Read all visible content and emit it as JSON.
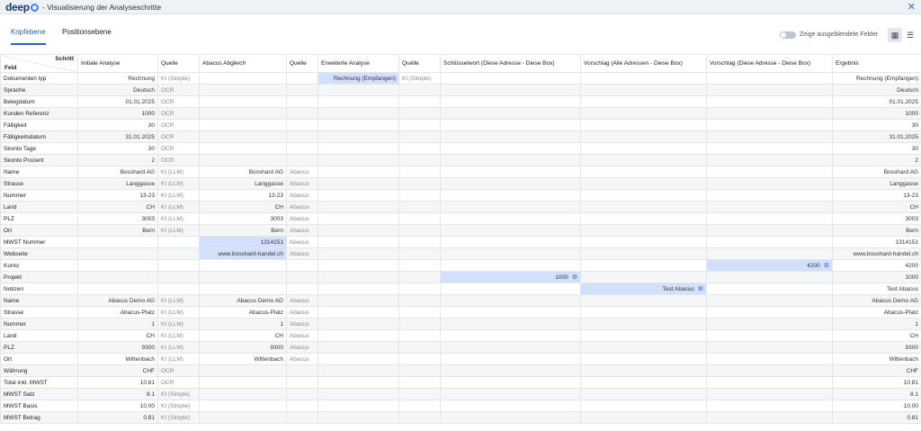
{
  "app": {
    "logo_text": "deep",
    "title": "- Visualisierung der Analyseschritte"
  },
  "tabs": [
    {
      "label": "Kopfebene",
      "active": true
    },
    {
      "label": "Positionsebene",
      "active": false
    }
  ],
  "toolbar": {
    "toggle_label": "Zeige ausgeblendete Felder",
    "toggle_on": false
  },
  "colors": {
    "accent": "#2a62c9",
    "highlight": "#d3e0fb",
    "row_alt": "#f5f6f8"
  },
  "table": {
    "corner_step": "Schritt",
    "corner_field": "Feld",
    "columns": [
      "Initiale Analyse",
      "Quelle",
      "Abacus Abgleich",
      "Quelle",
      "Erweiterte Analyse",
      "Quelle",
      "Schlüsselwort (Diese Adresse - Diese Box)",
      "Vorschlag (Alle Adressen - Diese Box)",
      "Vorschlag (Diese Adresse - Diese Box)",
      "Ergebnis"
    ],
    "rows": [
      {
        "field": "Dokumenten typ",
        "initial": "Rechnung",
        "src1": "KI (Simple)",
        "abacus": "",
        "src2": "",
        "extended": "Rechnung (Empfangen)",
        "src3": "KI (Simple)",
        "keyword": "",
        "sugg_all": "",
        "sugg_this": "",
        "result": "Rechnung (Empfangen)",
        "hl": "extended"
      },
      {
        "field": "Sprache",
        "initial": "Deutsch",
        "src1": "OCR",
        "abacus": "",
        "src2": "",
        "extended": "",
        "src3": "",
        "keyword": "",
        "sugg_all": "",
        "sugg_this": "",
        "result": "Deutsch",
        "hl": ""
      },
      {
        "field": "Belegdatum",
        "initial": "01.01.2025",
        "src1": "OCR",
        "abacus": "",
        "src2": "",
        "extended": "",
        "src3": "",
        "keyword": "",
        "sugg_all": "",
        "sugg_this": "",
        "result": "01.01.2025",
        "hl": ""
      },
      {
        "field": "Kunden Referenz",
        "initial": "1000",
        "src1": "OCR",
        "abacus": "",
        "src2": "",
        "extended": "",
        "src3": "",
        "keyword": "",
        "sugg_all": "",
        "sugg_this": "",
        "result": "1000",
        "hl": ""
      },
      {
        "field": "Fälligkeit",
        "initial": "30",
        "src1": "OCR",
        "abacus": "",
        "src2": "",
        "extended": "",
        "src3": "",
        "keyword": "",
        "sugg_all": "",
        "sugg_this": "",
        "result": "30",
        "hl": ""
      },
      {
        "field": "Fälligkeitsdatum",
        "initial": "31.01.2025",
        "src1": "OCR",
        "abacus": "",
        "src2": "",
        "extended": "",
        "src3": "",
        "keyword": "",
        "sugg_all": "",
        "sugg_this": "",
        "result": "31.01.2025",
        "hl": ""
      },
      {
        "field": "Skonto Tage",
        "initial": "30",
        "src1": "OCR",
        "abacus": "",
        "src2": "",
        "extended": "",
        "src3": "",
        "keyword": "",
        "sugg_all": "",
        "sugg_this": "",
        "result": "30",
        "hl": ""
      },
      {
        "field": "Skonto Prozent",
        "initial": "2",
        "src1": "OCR",
        "abacus": "",
        "src2": "",
        "extended": "",
        "src3": "",
        "keyword": "",
        "sugg_all": "",
        "sugg_this": "",
        "result": "2",
        "hl": ""
      },
      {
        "field": "Name",
        "initial": "Bosshard AG",
        "src1": "KI (LLM)",
        "abacus": "Bosshard AG",
        "src2": "Abacus",
        "extended": "",
        "src3": "",
        "keyword": "",
        "sugg_all": "",
        "sugg_this": "",
        "result": "Bosshard AG",
        "hl": ""
      },
      {
        "field": "Strasse",
        "initial": "Langgasse",
        "src1": "KI (LLM)",
        "abacus": "Langgasse",
        "src2": "Abacus",
        "extended": "",
        "src3": "",
        "keyword": "",
        "sugg_all": "",
        "sugg_this": "",
        "result": "Langgasse",
        "hl": ""
      },
      {
        "field": "Nummer",
        "initial": "13-23",
        "src1": "KI (LLM)",
        "abacus": "13-23",
        "src2": "Abacus",
        "extended": "",
        "src3": "",
        "keyword": "",
        "sugg_all": "",
        "sugg_this": "",
        "result": "13-23",
        "hl": ""
      },
      {
        "field": "Land",
        "initial": "CH",
        "src1": "KI (LLM)",
        "abacus": "CH",
        "src2": "Abacus",
        "extended": "",
        "src3": "",
        "keyword": "",
        "sugg_all": "",
        "sugg_this": "",
        "result": "CH",
        "hl": ""
      },
      {
        "field": "PLZ",
        "initial": "3003",
        "src1": "KI (LLM)",
        "abacus": "3003",
        "src2": "Abacus",
        "extended": "",
        "src3": "",
        "keyword": "",
        "sugg_all": "",
        "sugg_this": "",
        "result": "3003",
        "hl": ""
      },
      {
        "field": "Ort",
        "initial": "Bern",
        "src1": "KI (LLM)",
        "abacus": "Bern",
        "src2": "Abacus",
        "extended": "",
        "src3": "",
        "keyword": "",
        "sugg_all": "",
        "sugg_this": "",
        "result": "Bern",
        "hl": ""
      },
      {
        "field": "MWST Nummer",
        "initial": "",
        "src1": "",
        "abacus": "1314151",
        "src2": "Abacus",
        "extended": "",
        "src3": "",
        "keyword": "",
        "sugg_all": "",
        "sugg_this": "",
        "result": "1314151",
        "hl": "abacus"
      },
      {
        "field": "Webseite",
        "initial": "",
        "src1": "",
        "abacus": "www.bosshard-handel.ch",
        "src2": "Abacus",
        "extended": "",
        "src3": "",
        "keyword": "",
        "sugg_all": "",
        "sugg_this": "",
        "result": "www.bosshard-handel.ch",
        "hl": "abacus"
      },
      {
        "field": "Konto",
        "initial": "",
        "src1": "",
        "abacus": "",
        "src2": "",
        "extended": "",
        "src3": "",
        "keyword": "",
        "sugg_all": "",
        "sugg_this": "4200",
        "result": "4200",
        "hl": "sugg_this"
      },
      {
        "field": "Projekt",
        "initial": "",
        "src1": "",
        "abacus": "",
        "src2": "",
        "extended": "",
        "src3": "",
        "keyword": "1000",
        "sugg_all": "",
        "sugg_this": "",
        "result": "1000",
        "hl": "keyword"
      },
      {
        "field": "Notizen",
        "initial": "",
        "src1": "",
        "abacus": "",
        "src2": "",
        "extended": "",
        "src3": "",
        "keyword": "",
        "sugg_all": "Test Abacus",
        "sugg_this": "",
        "result": "Test Abacus",
        "hl": "sugg_all"
      },
      {
        "field": "Name",
        "initial": "Abacus Demo AG",
        "src1": "KI (LLM)",
        "abacus": "Abacus Demo AG",
        "src2": "Abacus",
        "extended": "",
        "src3": "",
        "keyword": "",
        "sugg_all": "",
        "sugg_this": "",
        "result": "Abacus Demo AG",
        "hl": ""
      },
      {
        "field": "Strasse",
        "initial": "Abacus-Platz",
        "src1": "KI (LLM)",
        "abacus": "Abacus-Platz",
        "src2": "Abacus",
        "extended": "",
        "src3": "",
        "keyword": "",
        "sugg_all": "",
        "sugg_this": "",
        "result": "Abacus-Platz",
        "hl": ""
      },
      {
        "field": "Nummer",
        "initial": "1",
        "src1": "KI (LLM)",
        "abacus": "1",
        "src2": "Abacus",
        "extended": "",
        "src3": "",
        "keyword": "",
        "sugg_all": "",
        "sugg_this": "",
        "result": "1",
        "hl": ""
      },
      {
        "field": "Land",
        "initial": "CH",
        "src1": "KI (LLM)",
        "abacus": "CH",
        "src2": "Abacus",
        "extended": "",
        "src3": "",
        "keyword": "",
        "sugg_all": "",
        "sugg_this": "",
        "result": "CH",
        "hl": ""
      },
      {
        "field": "PLZ",
        "initial": "9300",
        "src1": "KI (LLM)",
        "abacus": "9300",
        "src2": "Abacus",
        "extended": "",
        "src3": "",
        "keyword": "",
        "sugg_all": "",
        "sugg_this": "",
        "result": "9300",
        "hl": ""
      },
      {
        "field": "Ort",
        "initial": "Wittenbach",
        "src1": "KI (LLM)",
        "abacus": "Wittenbach",
        "src2": "Abacus",
        "extended": "",
        "src3": "",
        "keyword": "",
        "sugg_all": "",
        "sugg_this": "",
        "result": "Wittenbach",
        "hl": ""
      },
      {
        "field": "Währung",
        "initial": "CHF",
        "src1": "OCR",
        "abacus": "",
        "src2": "",
        "extended": "",
        "src3": "",
        "keyword": "",
        "sugg_all": "",
        "sugg_this": "",
        "result": "CHF",
        "hl": ""
      },
      {
        "field": "Total inkl. MWST",
        "initial": "10.81",
        "src1": "OCR",
        "abacus": "",
        "src2": "",
        "extended": "",
        "src3": "",
        "keyword": "",
        "sugg_all": "",
        "sugg_this": "",
        "result": "10.81",
        "hl": ""
      },
      {
        "field": "MWST Satz",
        "initial": "8.1",
        "src1": "KI (Simple)",
        "abacus": "",
        "src2": "",
        "extended": "",
        "src3": "",
        "keyword": "",
        "sugg_all": "",
        "sugg_this": "",
        "result": "8.1",
        "hl": ""
      },
      {
        "field": "MWST Basis",
        "initial": "10.00",
        "src1": "KI (Simple)",
        "abacus": "",
        "src2": "",
        "extended": "",
        "src3": "",
        "keyword": "",
        "sugg_all": "",
        "sugg_this": "",
        "result": "10.00",
        "hl": ""
      },
      {
        "field": "MWST Betrag",
        "initial": "0.81",
        "src1": "KI (Simple)",
        "abacus": "",
        "src2": "",
        "extended": "",
        "src3": "",
        "keyword": "",
        "sugg_all": "",
        "sugg_this": "",
        "result": "0.81",
        "hl": ""
      }
    ]
  }
}
